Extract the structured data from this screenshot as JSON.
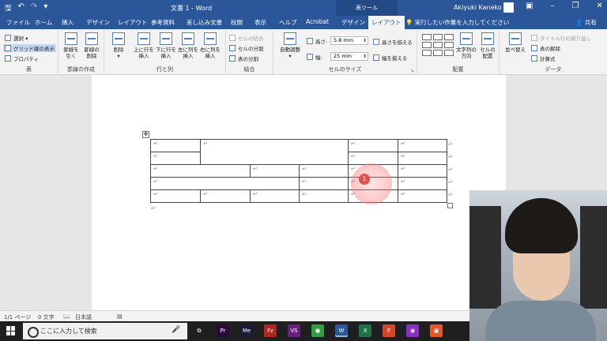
{
  "titlebar": {
    "doc_title": "文書 1  -  Word",
    "tool_tab_title": "表ツール",
    "user_name": "Akiyuki Kaneko",
    "qat_icons": [
      "save-icon",
      "undo-icon",
      "redo-icon",
      "customize-icon"
    ]
  },
  "tabs": [
    {
      "label": "ファイル"
    },
    {
      "label": "ホーム"
    },
    {
      "label": "挿入"
    },
    {
      "label": "デザイン"
    },
    {
      "label": "レイアウト"
    },
    {
      "label": "参考資料"
    },
    {
      "label": "差し込み文書"
    },
    {
      "label": "校閲"
    },
    {
      "label": "表示"
    },
    {
      "label": "ヘルプ"
    },
    {
      "label": "Acrobat"
    },
    {
      "label": "デザイン"
    },
    {
      "label": "レイアウト"
    }
  ],
  "tell_me": "実行したい作業を入力してください",
  "share": "共有",
  "ribbon": {
    "table": {
      "label": "表",
      "select": "選択 ▾",
      "gridlines": "グリッド線の表示",
      "properties": "プロパティ"
    },
    "draw": {
      "label": "罫線の作成",
      "draw_table": "罫線を\n引く",
      "eraser": "罫線の\n削除"
    },
    "rows_cols": {
      "label": "行と列",
      "delete": "削除",
      "insert_above": "上に行を\n挿入",
      "insert_below": "下に行を\n挿入",
      "insert_left": "左に列を\n挿入",
      "insert_right": "右に列を\n挿入"
    },
    "merge": {
      "label": "結合",
      "merge_cells": "セルの結合",
      "split_cells": "セルの分割",
      "split_table": "表の分割"
    },
    "cell_size": {
      "label": "セルのサイズ",
      "autofit": "自動調整",
      "height_label": "高さ:",
      "height_value": "5.8 mm",
      "width_label": "幅:",
      "width_value": "25 mm",
      "distribute_rows": "高さを揃える",
      "distribute_cols": "幅を揃える"
    },
    "alignment": {
      "label": "配置",
      "text_direction": "文字列の\n方向",
      "cell_margins": "セルの\n配置"
    },
    "data": {
      "label": "データ",
      "sort": "並べ替え",
      "repeat_header": "タイトル行の繰り返し",
      "convert_to_text": "表の解除",
      "formula": "計算式"
    }
  },
  "table_cells": {
    "mark": "↵"
  },
  "click_marker": "1",
  "statusbar": {
    "page": "1/1 ページ",
    "words": "0 文字",
    "language": "日本語"
  },
  "taskbar": {
    "search_placeholder": "ここに入力して検索",
    "apps": [
      {
        "name": "task-view-icon",
        "color": "#1f1f1f",
        "label": "⧉"
      },
      {
        "name": "premiere-icon",
        "color": "#2a0a3a",
        "label": "Pr"
      },
      {
        "name": "media-encoder-icon",
        "color": "#1a1a3a",
        "label": "Me"
      },
      {
        "name": "filezilla-icon",
        "color": "#b3261e",
        "label": "Fz"
      },
      {
        "name": "visual-studio-icon",
        "color": "#68217a",
        "label": "VS"
      },
      {
        "name": "line-icon",
        "color": "#2f9e44",
        "label": "●"
      },
      {
        "name": "word-icon",
        "color": "#2b579a",
        "label": "W"
      },
      {
        "name": "excel-icon",
        "color": "#217346",
        "label": "X"
      },
      {
        "name": "powerpoint-icon",
        "color": "#d24726",
        "label": "P"
      },
      {
        "name": "screen-record-icon",
        "color": "#8b2fc9",
        "label": "◉"
      },
      {
        "name": "app-icon",
        "color": "#e4572e",
        "label": "▣"
      }
    ]
  }
}
